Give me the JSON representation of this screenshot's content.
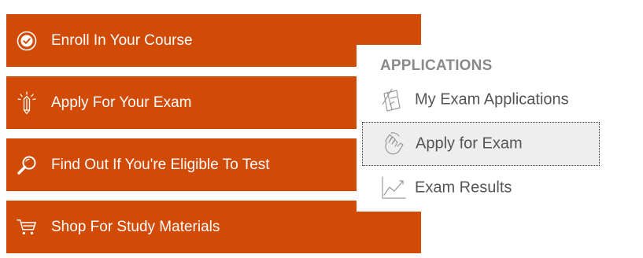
{
  "actions": [
    {
      "label": "Enroll In Your Course",
      "icon": "check-circle-icon"
    },
    {
      "label": "Apply For Your Exam",
      "icon": "pencil-idea-icon"
    },
    {
      "label": "Find Out If You're Eligible To Test",
      "icon": "magnifier-icon"
    },
    {
      "label": "Shop For Study Materials",
      "icon": "shopping-cart-icon"
    }
  ],
  "menu": {
    "title": "APPLICATIONS",
    "items": [
      {
        "label": "My Exam Applications",
        "icon": "document-compass-icon"
      },
      {
        "label": "Apply for Exam",
        "icon": "hand-pointer-icon",
        "selected": true
      },
      {
        "label": "Exam Results",
        "icon": "line-chart-icon"
      }
    ]
  },
  "colors": {
    "accent": "#d14a06",
    "menu_title": "#8a8a8a",
    "menu_text": "#555555",
    "selected_bg": "#eeeeee"
  }
}
